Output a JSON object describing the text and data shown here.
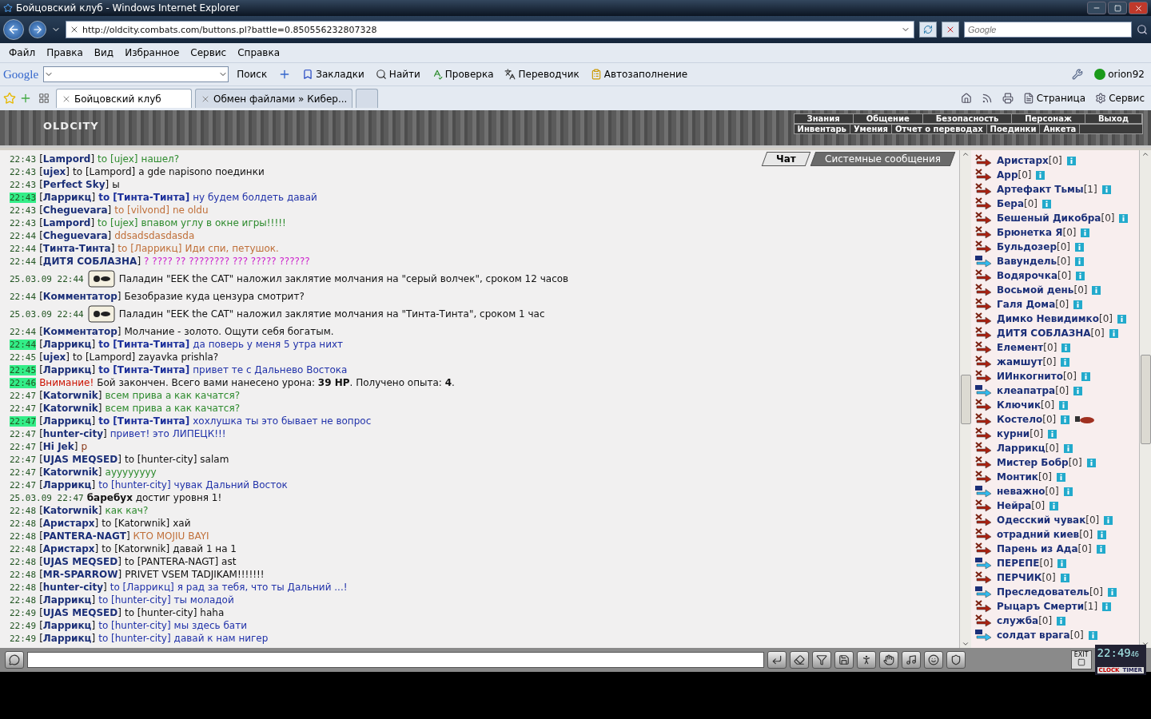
{
  "window": {
    "title": "Бойцовский клуб - Windows Internet Explorer"
  },
  "address": {
    "url": "http://oldcity.combats.com/buttons.pl?battle=0.850556232807328",
    "search_placeholder": "Google"
  },
  "menu": [
    "Файл",
    "Правка",
    "Вид",
    "Избранное",
    "Сервис",
    "Справка"
  ],
  "google_toolbar": {
    "logo": "Google",
    "search_button": "Поиск",
    "items": [
      "Закладки",
      "Найти",
      "Проверка",
      "Переводчик",
      "Автозаполнение"
    ],
    "account": "orion92"
  },
  "tabs": [
    {
      "label": "Бойцовский клуб",
      "selected": true
    },
    {
      "label": "Обмен файлами » Кибер...",
      "selected": false
    }
  ],
  "command_bar": [
    "Страница",
    "Сервис"
  ],
  "game": {
    "logo": "OLDCITY",
    "nav_top": [
      "Знания",
      "Общение",
      "Безопасность",
      "Персонаж",
      "Выход"
    ],
    "nav_bottom": [
      "Инвентарь",
      "Умения",
      "Отчет о переводах",
      "Поединки",
      "Анкета"
    ]
  },
  "chat_tabs": [
    {
      "label": "Чат",
      "selected": true
    },
    {
      "label": "Системные сообщения",
      "selected": false
    }
  ],
  "messages": [
    {
      "kind": "chat",
      "time": "22:43",
      "highlight": false,
      "sender": "[**Lampord**]",
      "to": "to [ujex]",
      "private": false,
      "text": "нашел?",
      "color": "#2e8b2e"
    },
    {
      "kind": "chat",
      "time": "22:43",
      "highlight": false,
      "sender": "[**ujex**]",
      "to": "to [Lampord]",
      "private": false,
      "text": "a gde napisono поединки",
      "color": "#111111"
    },
    {
      "kind": "chat",
      "time": "22:43",
      "highlight": false,
      "sender": "[**Perfect Sky**]",
      "text": "ы",
      "color": "#111111"
    },
    {
      "kind": "chat",
      "time": "22:43",
      "highlight": true,
      "sender": "[**Ларрикц**]",
      "to": "to [Тинта-Тинта]",
      "private": true,
      "text": "ну будем болдеть давай",
      "color": "#2233aa"
    },
    {
      "kind": "chat",
      "time": "22:43",
      "highlight": false,
      "sender": "[**Cheguevara**]",
      "to": "to [vilvond]",
      "private": false,
      "text": "ne oldu",
      "color": "#c0703a"
    },
    {
      "kind": "chat",
      "time": "22:43",
      "highlight": false,
      "sender": "[**Lampord**]",
      "to": "to [ujex]",
      "private": false,
      "text": "впавом углу в окне игры!!!!!",
      "color": "#2e8b2e"
    },
    {
      "kind": "chat",
      "time": "22:44",
      "highlight": false,
      "sender": "[**Cheguevara**]",
      "text": "ddsadsdasdasda",
      "color": "#c0703a"
    },
    {
      "kind": "chat",
      "time": "22:44",
      "highlight": false,
      "sender": "[**Тинта-Тинта**]",
      "to": "to [Ларрикц]",
      "private": false,
      "text": "Иди спи, петушок.",
      "color": "#c0703a"
    },
    {
      "kind": "chat",
      "time": "22:44",
      "highlight": false,
      "sender": "[**ДИТЯ СОБЛАЗНА**]",
      "text": "? ???? ?? ???????? ??? ????? ??????",
      "color": "#cc22cc"
    },
    {
      "kind": "spell",
      "time": "25.03.09 22:44",
      "highlight": false,
      "text": "Паладин \"EEK the CAT\" наложил заклятие молчания на \"серый волчек\", сроком 12 часов"
    },
    {
      "kind": "chat",
      "time": "22:44",
      "highlight": false,
      "sender": "[**Комментатор**]",
      "text": "Безобразие куда цензура смотрит?",
      "color": "#111111"
    },
    {
      "kind": "spell",
      "time": "25.03.09 22:44",
      "highlight": false,
      "text": "Паладин \"EEK the CAT\" наложил заклятие молчания на \"Тинта-Тинта\", сроком 1 час"
    },
    {
      "kind": "chat",
      "time": "22:44",
      "highlight": false,
      "sender": "[**Комментатор**]",
      "text": "Молчание - золото. Ощути себя богатым.",
      "color": "#111111"
    },
    {
      "kind": "chat",
      "time": "22:44",
      "highlight": true,
      "sender": "[**Ларрикц**]",
      "to": "to [Тинта-Тинта]",
      "private": true,
      "text": "да поверь у меня 5 утра нихт",
      "color": "#2233aa"
    },
    {
      "kind": "chat",
      "time": "22:45",
      "highlight": false,
      "sender": "[**ujex**]",
      "to": "to [Lampord]",
      "private": false,
      "text": "zayavka prishla?",
      "color": "#111111"
    },
    {
      "kind": "chat",
      "time": "22:45",
      "highlight": true,
      "sender": "[**Ларрикц**]",
      "to": "to [Тинта-Тинта]",
      "private": true,
      "text": "привет те с Дальнево Востока",
      "color": "#2233aa"
    },
    {
      "kind": "alert",
      "time": "22:46",
      "highlight": true,
      "label": "Внимание!",
      "text": "Бой закончен. Всего вами нанесено урона: **39 HP**. Получено опыта: **4**."
    },
    {
      "kind": "chat",
      "time": "22:47",
      "highlight": false,
      "sender": "[**Katorwnik**]",
      "text": "всем прива а как качатся?",
      "color": "#2e8b2e"
    },
    {
      "kind": "chat",
      "time": "22:47",
      "highlight": false,
      "sender": "[**Katorwnik**]",
      "text": "всем прива а как качатся?",
      "color": "#2e8b2e"
    },
    {
      "kind": "chat",
      "time": "22:47",
      "highlight": true,
      "sender": "[**Ларрикц**]",
      "to": "to [Тинта-Тинта]",
      "private": true,
      "text": "хохлушка ты это бывает не вопрос",
      "color": "#2233aa"
    },
    {
      "kind": "chat",
      "time": "22:47",
      "highlight": false,
      "sender": "[**hunter-city**]",
      "text": "привет! это ЛИПЕЦК!!!",
      "color": "#2233aa"
    },
    {
      "kind": "chat",
      "time": "22:47",
      "highlight": false,
      "sender": "[**Hi Jek**]",
      "text": "p",
      "color": "#8b3a1a"
    },
    {
      "kind": "chat",
      "time": "22:47",
      "highlight": false,
      "sender": "[**UJAS MEQSED**]",
      "to": "to [hunter-city]",
      "private": false,
      "text": "salam",
      "color": "#111111"
    },
    {
      "kind": "chat",
      "time": "22:47",
      "highlight": false,
      "sender": "[**Katorwnik**]",
      "text": "ayyyyyyyy",
      "color": "#2e8b2e"
    },
    {
      "kind": "chat",
      "time": "22:47",
      "highlight": false,
      "sender": "[**Ларрикц**]",
      "to": "to [hunter-city]",
      "private": false,
      "text": "чувак Дальний Восток",
      "color": "#2233aa"
    },
    {
      "kind": "level",
      "time": "25.03.09 22:47",
      "highlight": false,
      "text": "**баребух** достиг уровня 1!"
    },
    {
      "kind": "chat",
      "time": "22:48",
      "highlight": false,
      "sender": "[**Katorwnik**]",
      "text": "как кач?",
      "color": "#2e8b2e"
    },
    {
      "kind": "chat",
      "time": "22:48",
      "highlight": false,
      "sender": "[**Аристарх**]",
      "to": "to [Katorwnik]",
      "private": false,
      "text": "хай",
      "color": "#111111"
    },
    {
      "kind": "chat",
      "time": "22:48",
      "highlight": false,
      "sender": "[**PANTERA-NAGT**]",
      "text": "КТО MOJIU BAYI",
      "color": "#c0703a"
    },
    {
      "kind": "chat",
      "time": "22:48",
      "highlight": false,
      "sender": "[**Аристарх**]",
      "to": "to [Katorwnik]",
      "private": false,
      "text": "давай 1 на 1",
      "color": "#111111"
    },
    {
      "kind": "chat",
      "time": "22:48",
      "highlight": false,
      "sender": "[**UJAS MEQSED**]",
      "to": "to [PANTERA-NAGT]",
      "private": false,
      "text": "ast",
      "color": "#111111"
    },
    {
      "kind": "chat",
      "time": "22:48",
      "highlight": false,
      "sender": "[**MR-SPARROW**]",
      "text": "PRIVET VSEM TADJIKAM!!!!!!!",
      "color": "#111111"
    },
    {
      "kind": "chat",
      "time": "22:48",
      "highlight": false,
      "sender": "[**hunter-city**]",
      "to": "to [Ларрикц]",
      "private": false,
      "text": "я рад за тебя, что ты Дальний ...!",
      "color": "#2233aa"
    },
    {
      "kind": "chat",
      "time": "22:48",
      "highlight": false,
      "sender": "[**Ларрикц**]",
      "to": "to [hunter-city]",
      "private": false,
      "text": "ты моладой",
      "color": "#2233aa"
    },
    {
      "kind": "chat",
      "time": "22:49",
      "highlight": false,
      "sender": "[**UJAS MEQSED**]",
      "to": "to [hunter-city]",
      "private": false,
      "text": "haha",
      "color": "#111111"
    },
    {
      "kind": "chat",
      "time": "22:49",
      "highlight": false,
      "sender": "[**Ларрикц**]",
      "to": "to [hunter-city]",
      "private": false,
      "text": "мы здесь бати",
      "color": "#2233aa"
    },
    {
      "kind": "chat",
      "time": "22:49",
      "highlight": false,
      "sender": "[**Ларрикц**]",
      "to": "to [hunter-city]",
      "private": false,
      "text": "давай к нам нигер",
      "color": "#2233aa"
    }
  ],
  "users": [
    {
      "kind": "sword",
      "name": "Аристарх",
      "rank": "[0]",
      "muted": false
    },
    {
      "kind": "sword",
      "name": "Арр",
      "rank": "[0]",
      "muted": false
    },
    {
      "kind": "sword",
      "name": "Артефакт Тьмы",
      "rank": "[1]",
      "muted": false
    },
    {
      "kind": "sword",
      "name": "Бера",
      "rank": "[0]",
      "muted": false
    },
    {
      "kind": "sword",
      "name": "Бешеный Дикобра",
      "rank": "[0]",
      "muted": false
    },
    {
      "kind": "sword",
      "name": "Брюнетка Я",
      "rank": "[0]",
      "muted": false
    },
    {
      "kind": "sword",
      "name": "Бульдозер",
      "rank": "[0]",
      "muted": false
    },
    {
      "kind": "letter",
      "name": "Вавундель",
      "rank": "[0]",
      "muted": false
    },
    {
      "kind": "sword",
      "name": "Водярочка",
      "rank": "[0]",
      "muted": false
    },
    {
      "kind": "sword",
      "name": "Восьмой день",
      "rank": "[0]",
      "muted": false
    },
    {
      "kind": "sword",
      "name": "Галя Дома",
      "rank": "[0]",
      "muted": false
    },
    {
      "kind": "sword",
      "name": "Димко Невидимко",
      "rank": "[0]",
      "muted": false
    },
    {
      "kind": "sword",
      "name": "ДИТЯ СОБЛАЗНА",
      "rank": "[0]",
      "muted": false
    },
    {
      "kind": "sword",
      "name": "Елемент",
      "rank": "[0]",
      "muted": false
    },
    {
      "kind": "sword",
      "name": "жамшут",
      "rank": "[0]",
      "muted": false
    },
    {
      "kind": "sword",
      "name": "ИИнкогнито",
      "rank": "[0]",
      "muted": false
    },
    {
      "kind": "letter",
      "name": "клеапатра",
      "rank": "[0]",
      "muted": false
    },
    {
      "kind": "sword",
      "name": "Ключик",
      "rank": "[0]",
      "muted": false
    },
    {
      "kind": "sword",
      "name": "Костело",
      "rank": "[0]",
      "muted": true
    },
    {
      "kind": "sword",
      "name": "курни",
      "rank": "[0]",
      "muted": false
    },
    {
      "kind": "sword",
      "name": "Ларрикц",
      "rank": "[0]",
      "muted": false
    },
    {
      "kind": "sword",
      "name": "Мистер Бобр",
      "rank": "[0]",
      "muted": false
    },
    {
      "kind": "sword",
      "name": "Монтик",
      "rank": "[0]",
      "muted": false
    },
    {
      "kind": "letter",
      "name": "неважно",
      "rank": "[0]",
      "muted": false
    },
    {
      "kind": "sword",
      "name": "Нейра",
      "rank": "[0]",
      "muted": false
    },
    {
      "kind": "sword",
      "name": "Одесский чувак",
      "rank": "[0]",
      "muted": false
    },
    {
      "kind": "sword",
      "name": "отрадний киев",
      "rank": "[0]",
      "muted": false
    },
    {
      "kind": "sword",
      "name": "Парень из Ада",
      "rank": "[0]",
      "muted": false
    },
    {
      "kind": "letter",
      "name": "ПЕРЕПЕ",
      "rank": "[0]",
      "muted": false
    },
    {
      "kind": "sword",
      "name": "ПЕРЧИК",
      "rank": "[0]",
      "muted": false
    },
    {
      "kind": "letter",
      "name": "Преследователь",
      "rank": "[0]",
      "muted": false
    },
    {
      "kind": "sword",
      "name": "Рыцаръ Смерти",
      "rank": "[1]",
      "muted": false
    },
    {
      "kind": "sword",
      "name": "служба",
      "rank": "[0]",
      "muted": false
    },
    {
      "kind": "letter",
      "name": "солдат врага",
      "rank": "[0]",
      "muted": false
    }
  ],
  "clock": {
    "exit": "EXIT",
    "time": "22:49",
    "seconds": "46",
    "clock_label": "CLOCK",
    "timer_label": "TIMER"
  }
}
